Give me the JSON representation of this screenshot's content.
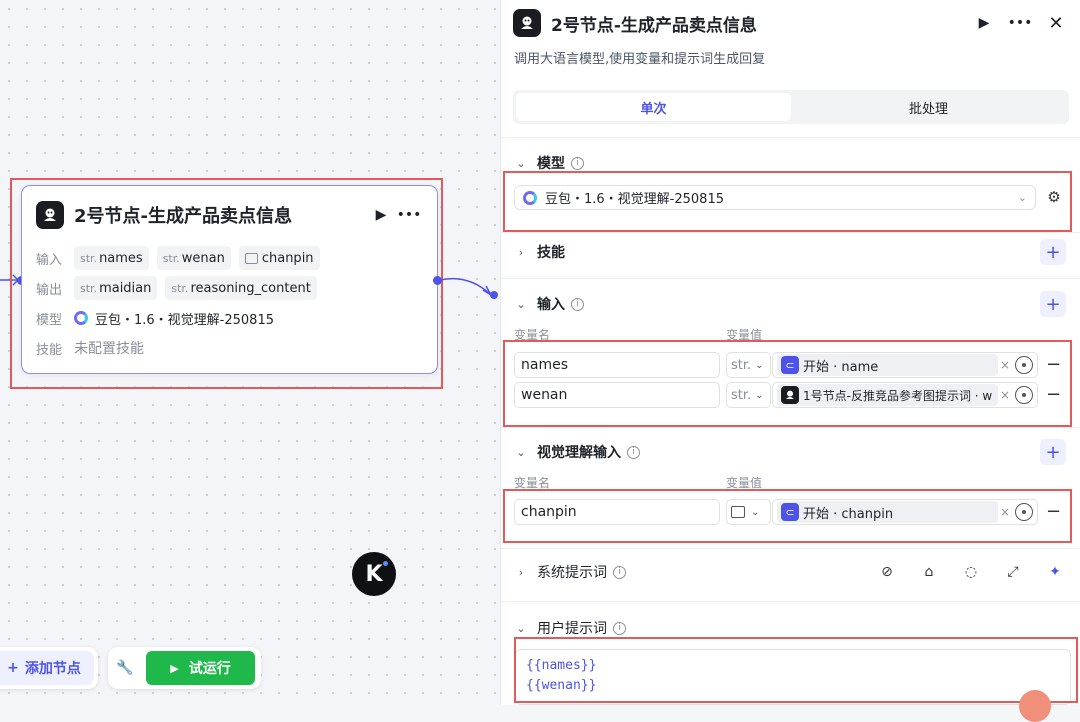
{
  "node": {
    "title": "2号节点-生成产品卖点信息",
    "input_label": "输入",
    "inputs": [
      {
        "type": "str.",
        "name": "names"
      },
      {
        "type": "str.",
        "name": "wenan"
      },
      {
        "type": "image",
        "name": "chanpin"
      }
    ],
    "output_label": "输出",
    "outputs": [
      {
        "type": "str.",
        "name": "maidian"
      },
      {
        "type": "str.",
        "name": "reasoning_content"
      }
    ],
    "model_label": "模型",
    "model": "豆包・1.6・视觉理解-250815",
    "skill_label": "技能",
    "skill_value": "未配置技能"
  },
  "toolbar": {
    "add_node": "添加节点",
    "run": "试运行"
  },
  "badge_letter": "K",
  "panel": {
    "title": "2号节点-生成产品卖点信息",
    "description": "调用大语言模型,使用变量和提示词生成回复",
    "tabs": [
      "单次",
      "批处理"
    ],
    "model_section": "模型",
    "model_value": "豆包・1.6・视觉理解-250815",
    "skills_section": "技能",
    "input_section": "输入",
    "col_var_name": "变量名",
    "col_var_value": "变量值",
    "inputs": [
      {
        "name": "names",
        "type": "str.",
        "ref": "开始 · name",
        "ref_source": "start"
      },
      {
        "name": "wenan",
        "type": "str.",
        "ref": "1号节点-反推竞品参考图提示词 · w",
        "ref_source": "node"
      }
    ],
    "vision_section": "视觉理解输入",
    "vision_inputs": [
      {
        "name": "chanpin",
        "type": "image",
        "ref": "开始 · chanpin"
      }
    ],
    "system_prompt_section": "系统提示词",
    "user_prompt_section": "用户提示词",
    "user_prompt_lines": [
      "{{names}}",
      "{{wenan}}"
    ]
  },
  "colors": {
    "accent": "#4d53e8",
    "run_green": "#1fb84b",
    "highlight_red": "#e45a5a"
  }
}
